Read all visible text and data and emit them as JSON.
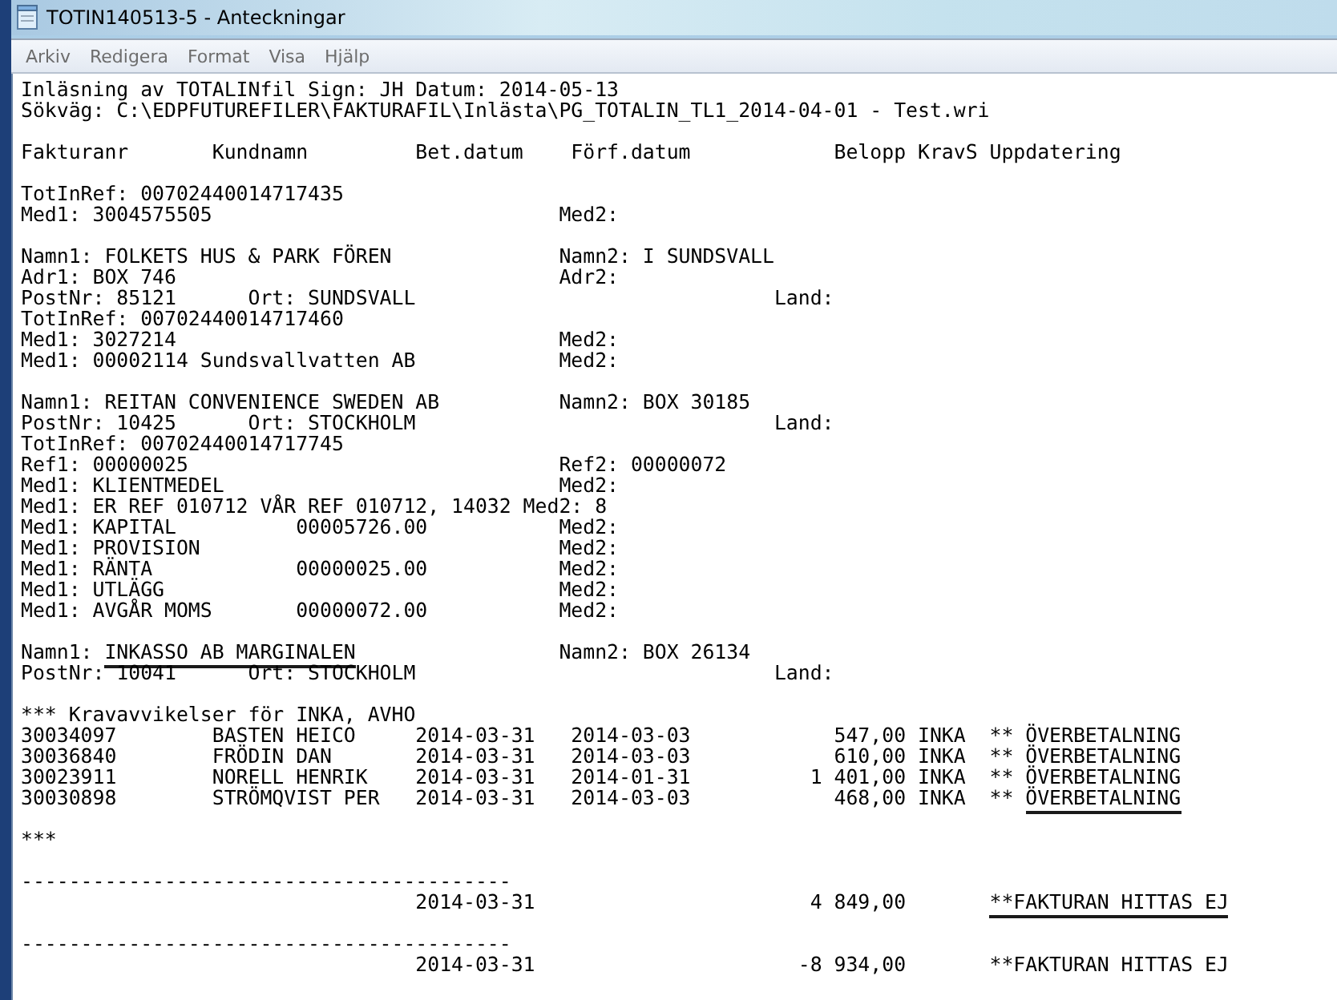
{
  "window": {
    "title": "TOTIN140513-5 - Anteckningar"
  },
  "menu": [
    "Arkiv",
    "Redigera",
    "Format",
    "Visa",
    "Hjälp"
  ],
  "document": {
    "blocks": [
      {
        "lines": [
          [
            {
              "text": "Inläsning av TOTALINfil Sign: JH Datum: 2014-05-13",
              "marked": false
            }
          ],
          [
            {
              "text": "Sökväg: C:\\EDPFUTUREFILER\\FAKTURAFIL\\Inlästa\\PG_TOTALIN_TL1_2014-04-01 - Test.wri",
              "marked": false
            }
          ]
        ]
      },
      {
        "lines": [
          [
            {
              "text": "Fakturanr       Kundnamn         Bet.datum    Förf.datum            Belopp KravS Uppdatering",
              "marked": false
            }
          ]
        ]
      },
      {
        "lines": [
          [
            {
              "text": "TotInRef: 00702440014717435",
              "marked": false
            }
          ],
          [
            {
              "text": "Med1: 3004575505                             Med2:",
              "marked": false
            }
          ]
        ]
      },
      {
        "lines": [
          [
            {
              "text": "Namn1: FOLKETS HUS & PARK FÖREN              Namn2: I SUNDSVALL",
              "marked": false
            }
          ],
          [
            {
              "text": "Adr1: BOX 746                                Adr2:",
              "marked": false
            }
          ],
          [
            {
              "text": "PostNr: 85121      Ort: SUNDSVALL                              Land:",
              "marked": false
            }
          ],
          [
            {
              "text": "TotInRef: 00702440014717460",
              "marked": false
            }
          ],
          [
            {
              "text": "Med1: 3027214                                Med2:",
              "marked": false
            }
          ],
          [
            {
              "text": "Med1: 00002114 Sundsvallvatten AB            Med2:",
              "marked": false
            }
          ]
        ]
      },
      {
        "lines": [
          [
            {
              "text": "Namn1: REITAN CONVENIENCE SWEDEN AB          Namn2: BOX 30185",
              "marked": false
            }
          ],
          [
            {
              "text": "PostNr: 10425      Ort: STOCKHOLM                              Land:",
              "marked": false
            }
          ],
          [
            {
              "text": "TotInRef: 00702440014717745",
              "marked": false
            }
          ],
          [
            {
              "text": "Ref1: 00000025                               Ref2: 00000072",
              "marked": false
            }
          ],
          [
            {
              "text": "Med1: KLIENTMEDEL                            Med2:",
              "marked": false
            }
          ],
          [
            {
              "text": "Med1: ER REF 010712 VÅR REF 010712, 14032 Med2: 8",
              "marked": false
            }
          ],
          [
            {
              "text": "Med1: KAPITAL          00005726.00           Med2:",
              "marked": false
            }
          ],
          [
            {
              "text": "Med1: PROVISION                              Med2:",
              "marked": false
            }
          ],
          [
            {
              "text": "Med1: RÄNTA            00000025.00           Med2:",
              "marked": false
            }
          ],
          [
            {
              "text": "Med1: UTLÄGG                                 Med2:",
              "marked": false
            }
          ],
          [
            {
              "text": "Med1: AVGÅR MOMS       00000072.00           Med2:",
              "marked": false
            }
          ]
        ]
      },
      {
        "lines": [
          [
            {
              "text": "Namn1: ",
              "marked": false
            },
            {
              "text": "INKASSO AB MARGINALEN",
              "marked": true
            },
            {
              "text": "                 Namn2: BOX 26134",
              "marked": false
            }
          ],
          [
            {
              "text": "PostNr: 10041      Ort: STOCKHOLM                              Land:",
              "marked": false
            }
          ]
        ]
      },
      {
        "lines": [
          [
            {
              "text": "*** Kravavvikelser för INKA, AVHO",
              "marked": false
            }
          ],
          [
            {
              "text": "30034097        BASTEN HEICO     2014-03-31   2014-03-03            547,00 INKA  ** ÖVERBETALNING",
              "marked": false
            }
          ],
          [
            {
              "text": "30036840        FRÖDIN DAN       2014-03-31   2014-03-03            610,00 INKA  ** ÖVERBETALNING",
              "marked": false
            }
          ],
          [
            {
              "text": "30023911        NORELL HENRIK    2014-03-31   2014-01-31          1 401,00 INKA  ** ÖVERBETALNING",
              "marked": false
            }
          ],
          [
            {
              "text": "30030898        STRÖMQVIST PER   2014-03-31   2014-03-03            468,00 INKA  ** ",
              "marked": false
            },
            {
              "text": "ÖVERBETALNING",
              "marked": true
            }
          ]
        ]
      },
      {
        "lines": [
          [
            {
              "text": "***",
              "marked": false
            }
          ]
        ]
      },
      {
        "lines": [
          [
            {
              "text": "-----------------------------------------",
              "marked": false
            }
          ],
          [
            {
              "text": "                                 2014-03-31                       4 849,00       ",
              "marked": false
            },
            {
              "text": "**FAKTURAN HITTAS EJ",
              "marked": true
            }
          ]
        ]
      },
      {
        "lines": [
          [
            {
              "text": "-----------------------------------------",
              "marked": false
            }
          ],
          [
            {
              "text": "                                 2014-03-31                      -8 934,00       **FAKTURAN HITTAS EJ",
              "marked": false
            }
          ]
        ]
      }
    ]
  }
}
